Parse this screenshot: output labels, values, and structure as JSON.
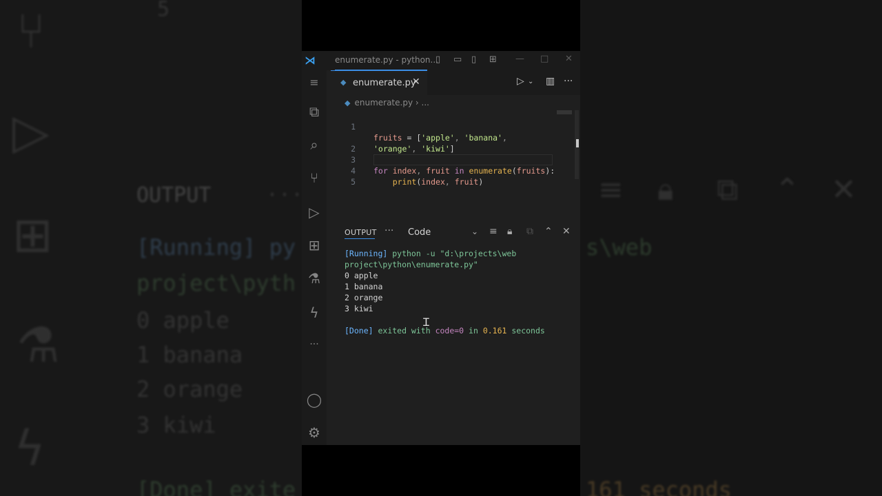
{
  "window": {
    "title": "enumerate.py - python...",
    "accent": "#3b8ee6"
  },
  "tabs": [
    {
      "label": "enumerate.py",
      "icon": "python-file-icon"
    }
  ],
  "breadcrumb": {
    "file": "enumerate.py",
    "sep": "›",
    "more": "..."
  },
  "editor": {
    "lines": [
      {
        "num": "1"
      },
      {
        "num": ""
      },
      {
        "num": "2"
      },
      {
        "num": "3"
      },
      {
        "num": "4"
      },
      {
        "num": "5"
      }
    ],
    "code": {
      "l1_a": "fruits",
      "l1_b": " = [",
      "l1_c": "'apple'",
      "l1_d": ", ",
      "l1_e": "'banana'",
      "l1_f": ",",
      "l1w_a": "'orange'",
      "l1w_b": ", ",
      "l1w_c": "'kiwi'",
      "l1w_d": "]",
      "l3_a": "for",
      "l3_b": " index",
      "l3_c": ", ",
      "l3_d": "fruit",
      "l3_e": " in ",
      "l3_f": "enumerate",
      "l3_g": "(",
      "l3_h": "fruits",
      "l3_i": "):",
      "l4_a": "    print",
      "l4_b": "(",
      "l4_c": "index",
      "l4_d": ", ",
      "l4_e": "fruit",
      "l4_f": ")"
    }
  },
  "panel": {
    "tab": "OUTPUT",
    "dots": "···",
    "selected_channel": "Code",
    "output": {
      "running_tag": "[Running]",
      "running_cmd1": " python -u \"d:\\projects\\web",
      "running_cmd2": "project\\python\\enumerate.py\"",
      "rows": [
        "0 apple",
        "1 banana",
        "2 orange",
        "3 kiwi"
      ],
      "done_tag": "[Done]",
      "done_a": " exited with ",
      "done_b": "code=0",
      "done_c": " in ",
      "done_d": "0.161",
      "done_e": " seconds"
    }
  },
  "background_echo": {
    "five": "5",
    "output": "OUTPUT",
    "dots": "···",
    "running": "[Running] py",
    "web": "s\\web",
    "project": "project\\pyth",
    "r0": "0 apple",
    "r1": "1 banana",
    "r2": "2 orange",
    "r3": "3 kiwi",
    "done": "[Done] exite",
    "secs": "161 seconds"
  }
}
